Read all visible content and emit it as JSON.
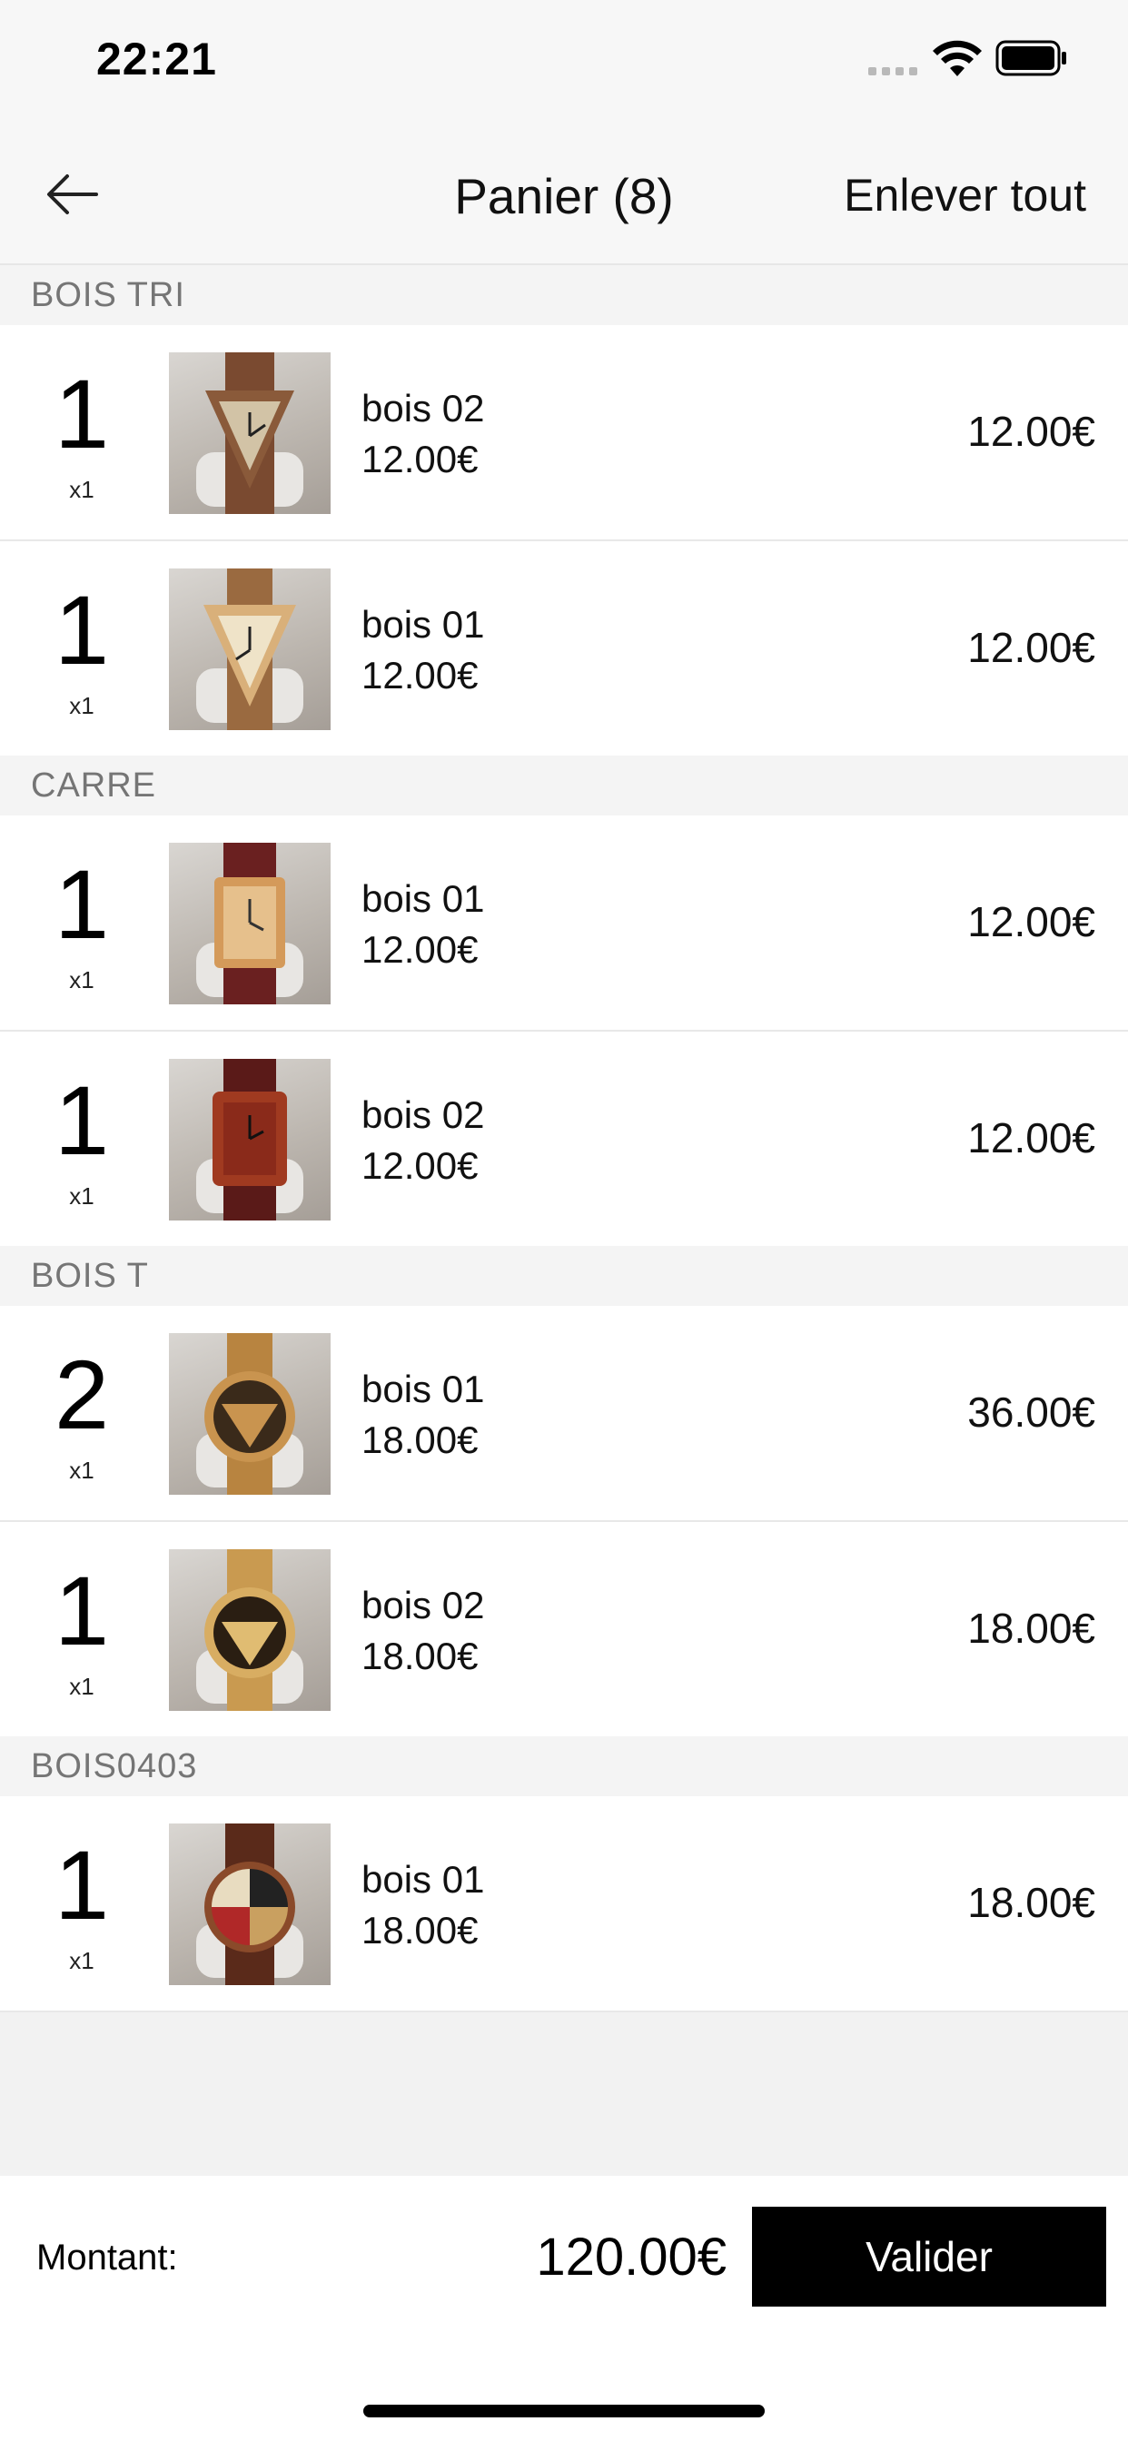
{
  "status_bar": {
    "time": "22:21",
    "icons": [
      "signal-icon",
      "wifi-icon",
      "battery-icon"
    ]
  },
  "nav": {
    "back_icon": "arrow-left-icon",
    "title": "Panier (8)",
    "clear_all": "Enlever tout"
  },
  "sections": [
    {
      "title": "BOIS TRI",
      "items": [
        {
          "qty": "1",
          "mult": "x1",
          "name": "bois 02",
          "unit_price": "12.00€",
          "total": "12.00€",
          "face": "triangle",
          "case_color": "#8a5a3a",
          "strap_color": "#7a4a30"
        },
        {
          "qty": "1",
          "mult": "x1",
          "name": "bois 01",
          "unit_price": "12.00€",
          "total": "12.00€",
          "face": "triangle",
          "case_color": "#d9b07a",
          "strap_color": "#9a6a40"
        }
      ]
    },
    {
      "title": "CARRE",
      "items": [
        {
          "qty": "1",
          "mult": "x1",
          "name": "bois 01",
          "unit_price": "12.00€",
          "total": "12.00€",
          "face": "square",
          "case_color": "#d49a5a",
          "strap_color": "#6a2020"
        },
        {
          "qty": "1",
          "mult": "x1",
          "name": "bois 02",
          "unit_price": "12.00€",
          "total": "12.00€",
          "face": "square",
          "case_color": "#a03a20",
          "strap_color": "#5a1a18"
        }
      ]
    },
    {
      "title": "BOIS T",
      "items": [
        {
          "qty": "2",
          "mult": "x1",
          "name": "bois 01",
          "unit_price": "18.00€",
          "total": "36.00€",
          "face": "round",
          "case_color": "#c9944f",
          "strap_color": "#b88440"
        },
        {
          "qty": "1",
          "mult": "x1",
          "name": "bois 02",
          "unit_price": "18.00€",
          "total": "18.00€",
          "face": "round",
          "case_color": "#d8ad62",
          "strap_color": "#c99a50"
        }
      ]
    },
    {
      "title": "BOIS0403",
      "items": [
        {
          "qty": "1",
          "mult": "x1",
          "name": "bois 01",
          "unit_price": "18.00€",
          "total": "18.00€",
          "face": "quad",
          "case_color": "#8a4a2a",
          "strap_color": "#5a2a1a"
        }
      ]
    }
  ],
  "footer": {
    "total_label": "Montant:",
    "total_value": "120.00€",
    "validate": "Valider"
  }
}
